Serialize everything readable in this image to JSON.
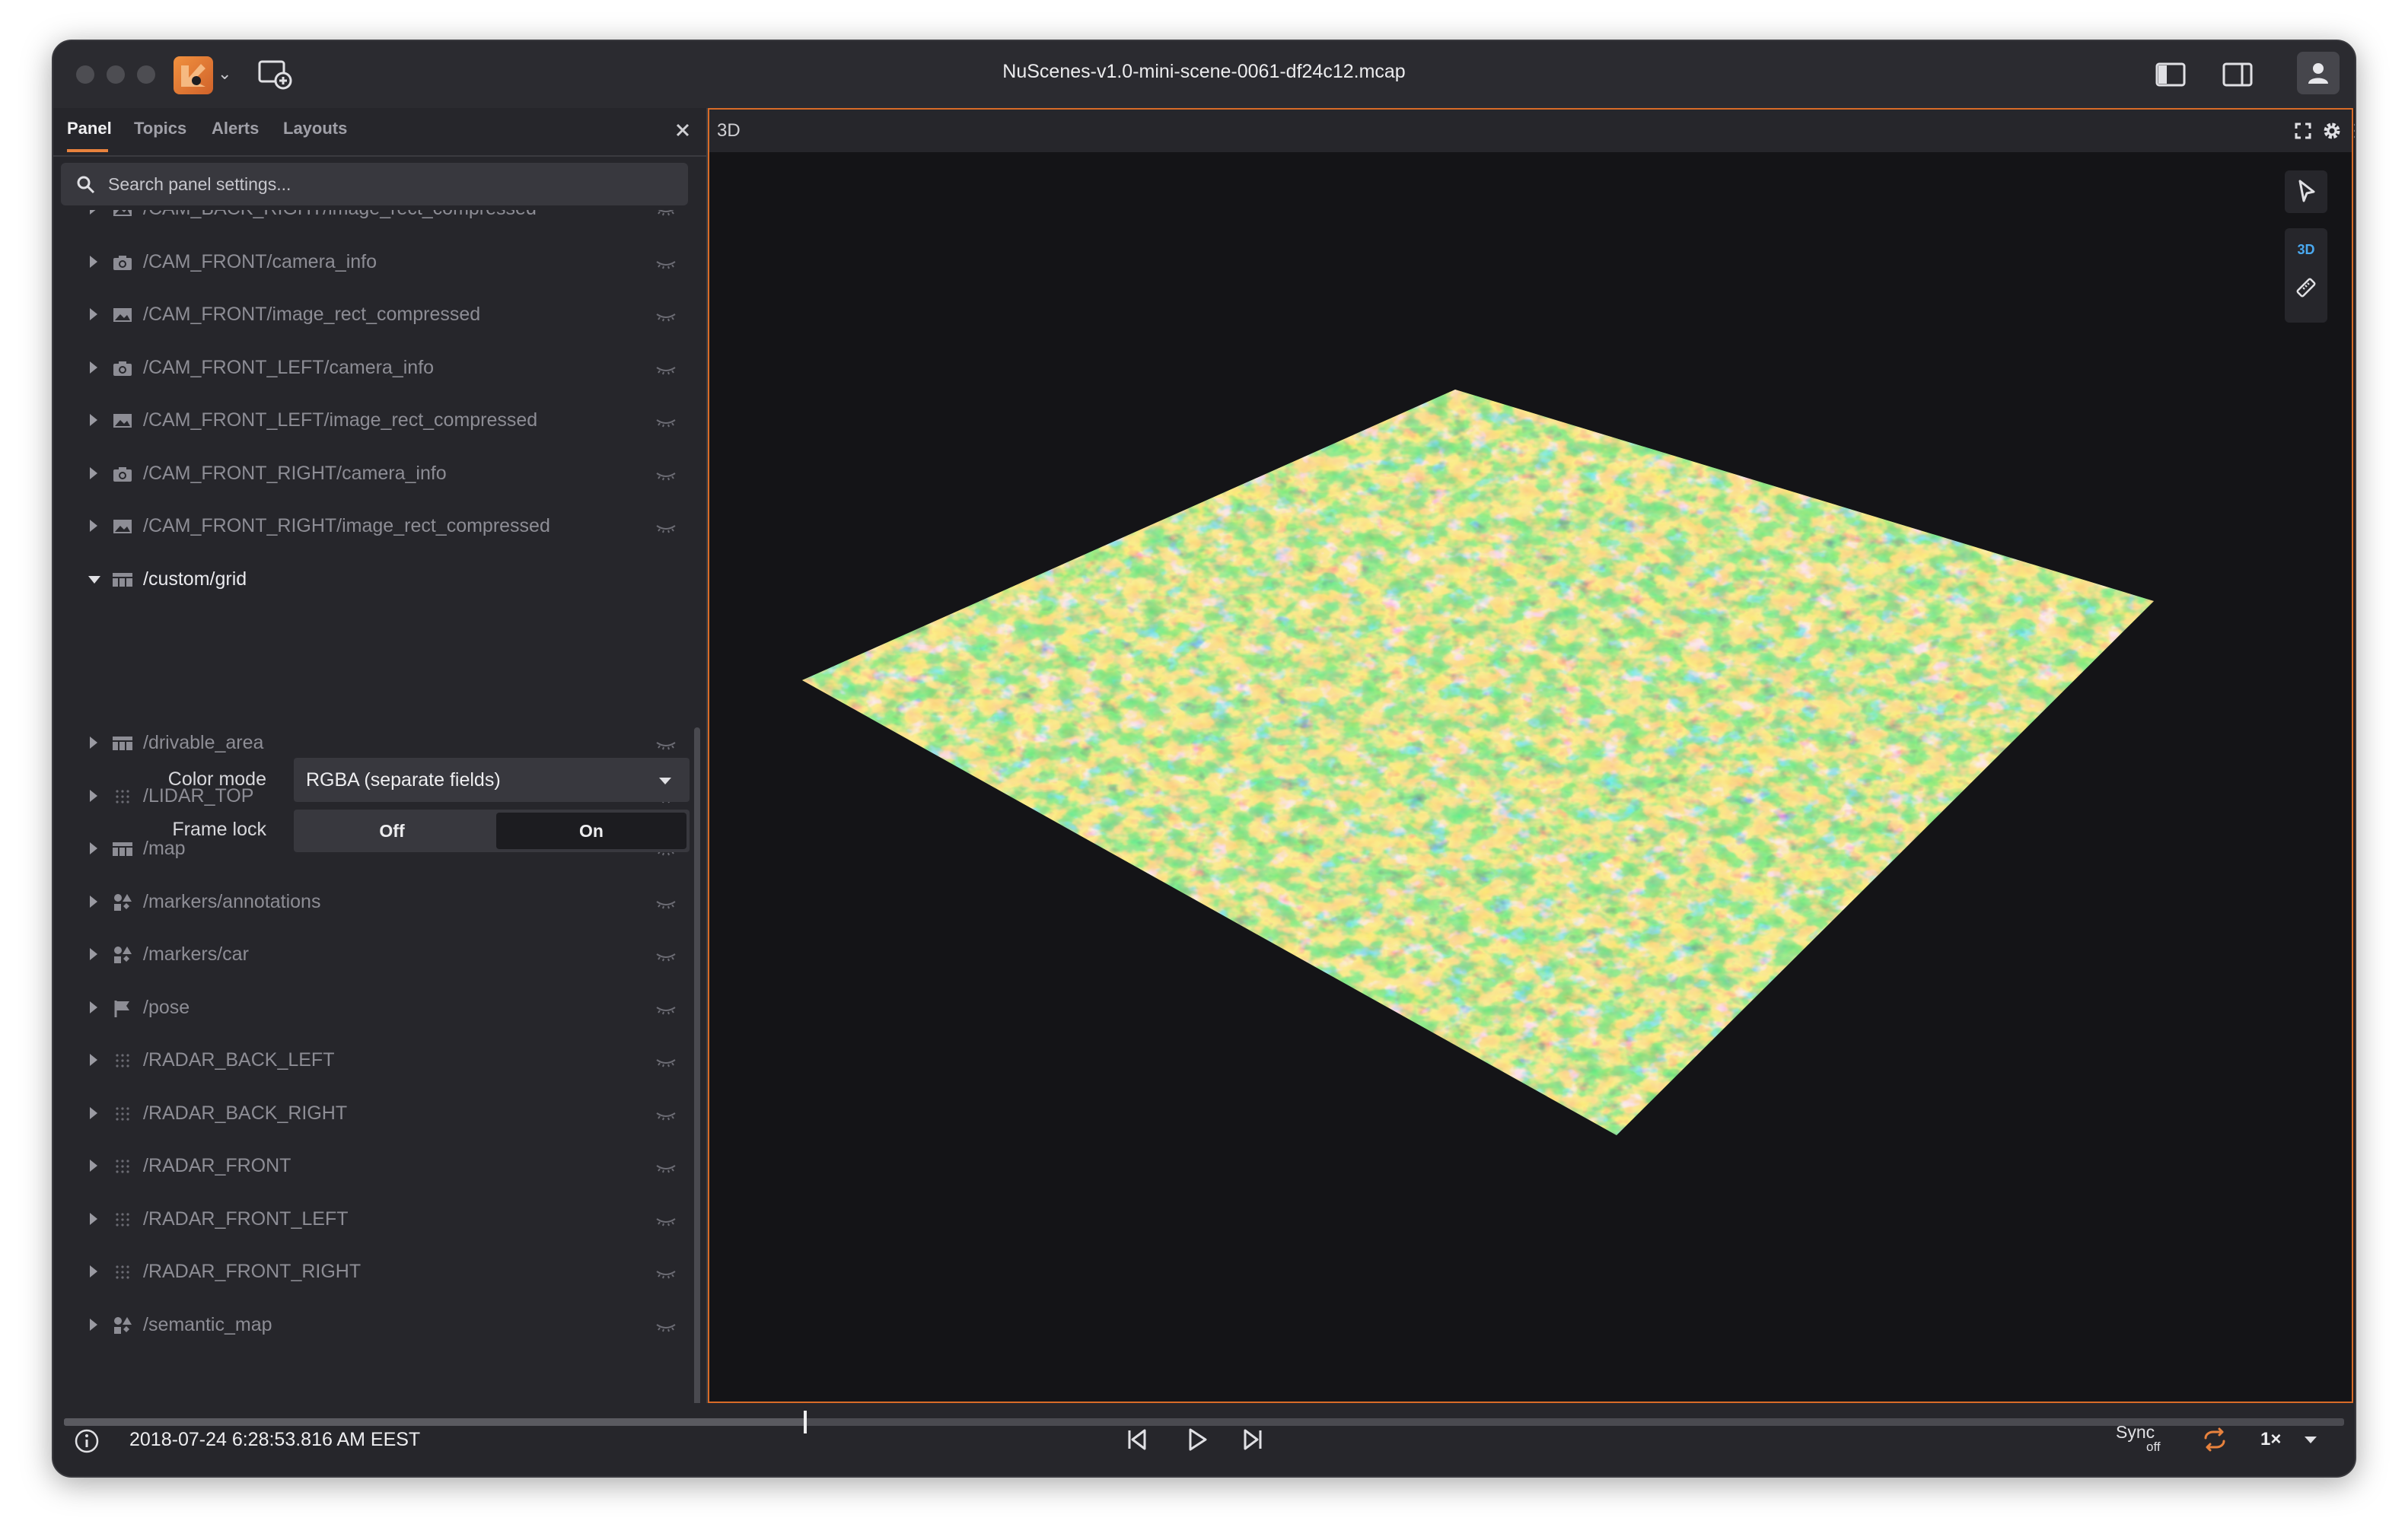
{
  "window": {
    "title": "NuScenes-v1.0-mini-scene-0061-df24c12.mcap"
  },
  "sidebar": {
    "tabs": [
      "Panel",
      "Topics",
      "Alerts",
      "Layouts"
    ],
    "search": {
      "placeholder": "Search panel settings..."
    },
    "topics": [
      {
        "label": "/CAM_BACK_RIGHT/image_rect_compressed",
        "icon": "image-icon",
        "expanded": false
      },
      {
        "label": "/CAM_FRONT/camera_info",
        "icon": "camera-icon",
        "expanded": false
      },
      {
        "label": "/CAM_FRONT/image_rect_compressed",
        "icon": "image-icon",
        "expanded": false
      },
      {
        "label": "/CAM_FRONT_LEFT/camera_info",
        "icon": "camera-icon",
        "expanded": false
      },
      {
        "label": "/CAM_FRONT_LEFT/image_rect_compressed",
        "icon": "image-icon",
        "expanded": false
      },
      {
        "label": "/CAM_FRONT_RIGHT/camera_info",
        "icon": "camera-icon",
        "expanded": false
      },
      {
        "label": "/CAM_FRONT_RIGHT/image_rect_compressed",
        "icon": "image-icon",
        "expanded": false
      },
      {
        "label": "/custom/grid",
        "icon": "grid-icon",
        "expanded": true
      },
      {
        "label": "/drivable_area",
        "icon": "grid-icon",
        "expanded": false
      },
      {
        "label": "/LIDAR_TOP",
        "icon": "points-icon",
        "expanded": false
      },
      {
        "label": "/map",
        "icon": "grid-icon",
        "expanded": false
      },
      {
        "label": "/markers/annotations",
        "icon": "shapes-icon",
        "expanded": false
      },
      {
        "label": "/markers/car",
        "icon": "shapes-icon",
        "expanded": false
      },
      {
        "label": "/pose",
        "icon": "flag-icon",
        "expanded": false
      },
      {
        "label": "/RADAR_BACK_LEFT",
        "icon": "points-icon",
        "expanded": false
      },
      {
        "label": "/RADAR_BACK_RIGHT",
        "icon": "points-icon",
        "expanded": false
      },
      {
        "label": "/RADAR_FRONT",
        "icon": "points-icon",
        "expanded": false
      },
      {
        "label": "/RADAR_FRONT_LEFT",
        "icon": "points-icon",
        "expanded": false
      },
      {
        "label": "/RADAR_FRONT_RIGHT",
        "icon": "points-icon",
        "expanded": false
      },
      {
        "label": "/semantic_map",
        "icon": "shapes-icon",
        "expanded": false
      }
    ],
    "grid_settings": {
      "color_mode_label": "Color mode",
      "color_mode_value": "RGBA (separate fields)",
      "frame_lock_label": "Frame lock",
      "frame_lock_off": "Off",
      "frame_lock_on": "On",
      "frame_lock_selected": "On"
    }
  },
  "panel": {
    "title": "3D",
    "toolbar_3d_label": "3D"
  },
  "playback": {
    "timestamp": "2018-07-24 6:28:53.816 AM EEST",
    "progress": 0.325,
    "sync_label": "Sync",
    "sync_state": "off",
    "speed": "1×"
  },
  "colors": {
    "accent": "#e8823d",
    "panel_border": "#d86b28",
    "tool_blue": "#4aa9f0",
    "loop_icon": "#e8823d"
  }
}
